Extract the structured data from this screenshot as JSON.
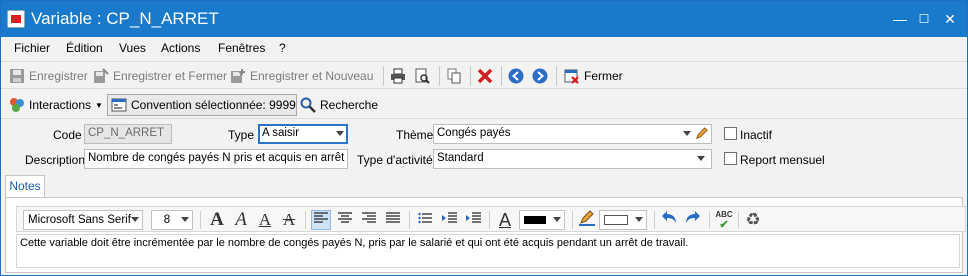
{
  "window": {
    "title": "Variable : CP_N_ARRET",
    "controls": {
      "minimize": "—",
      "maximize": "☐",
      "close": "✕"
    }
  },
  "menu": [
    "Fichier",
    "Édition",
    "Vues",
    "Actions",
    "Fenêtres",
    "?"
  ],
  "toolbar": {
    "save": "Enregistrer",
    "save_close": "Enregistrer et Fermer",
    "save_new": "Enregistrer et Nouveau",
    "close": "Fermer"
  },
  "toolbar2": {
    "interactions": "Interactions",
    "convention": "Convention sélectionnée: 9999",
    "search": "Recherche"
  },
  "form": {
    "code_label": "Code",
    "code_value": "CP_N_ARRET",
    "type_label": "Type",
    "type_value": "A saisir",
    "theme_label": "Thème",
    "theme_value": "Congés payés",
    "inactive_label": "Inactif",
    "description_label": "Description",
    "description_value": "Nombre de congés payés N pris et acquis en arrêt",
    "activity_label": "Type d'activité",
    "activity_value": "Standard",
    "monthly_label": "Report mensuel"
  },
  "tabs": [
    "Notes"
  ],
  "editor": {
    "font": "Microsoft Sans Serif",
    "size": "8",
    "text": "Cette variable doit être incrémentée par le nombre de congés payés N, pris par le salarié et qui ont été acquis pendant un arrêt de travail.",
    "spell_label": "ABC"
  },
  "colors": {
    "titlebar": "#1979ca",
    "delete_red": "#d21f1f",
    "nav_blue": "#2b6cc4"
  }
}
